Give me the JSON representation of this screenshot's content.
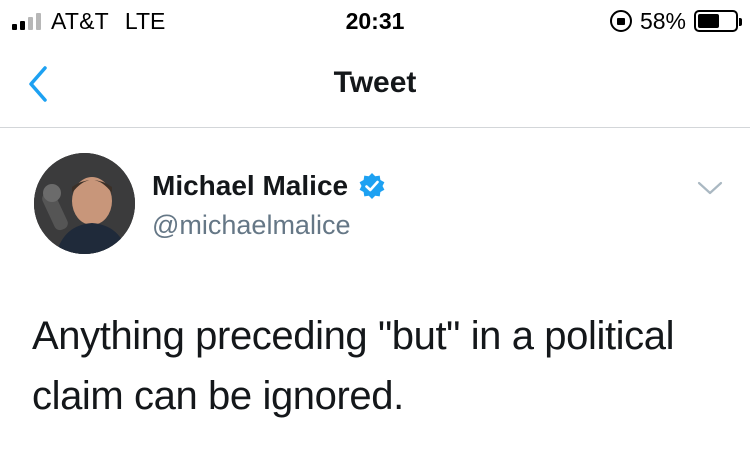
{
  "status_bar": {
    "carrier": "AT&T",
    "network": "LTE",
    "time": "20:31",
    "battery_percent_label": "58%",
    "battery_level": 0.58,
    "signal_bars_filled": 2,
    "signal_bars_total": 4
  },
  "nav": {
    "title": "Tweet",
    "back_icon": "chevron-left-icon",
    "accent_color": "#1da1f2"
  },
  "tweet": {
    "author": {
      "display_name": "Michael Malice",
      "handle": "@michaelmalice",
      "verified": true
    },
    "text": "Anything preceding \"but\" in a political claim can be ignored.",
    "menu_icon": "chevron-down-icon"
  },
  "colors": {
    "text_primary": "#14171a",
    "text_secondary": "#657786",
    "divider": "#d3d6d9",
    "verified_badge": "#1da1f2"
  }
}
